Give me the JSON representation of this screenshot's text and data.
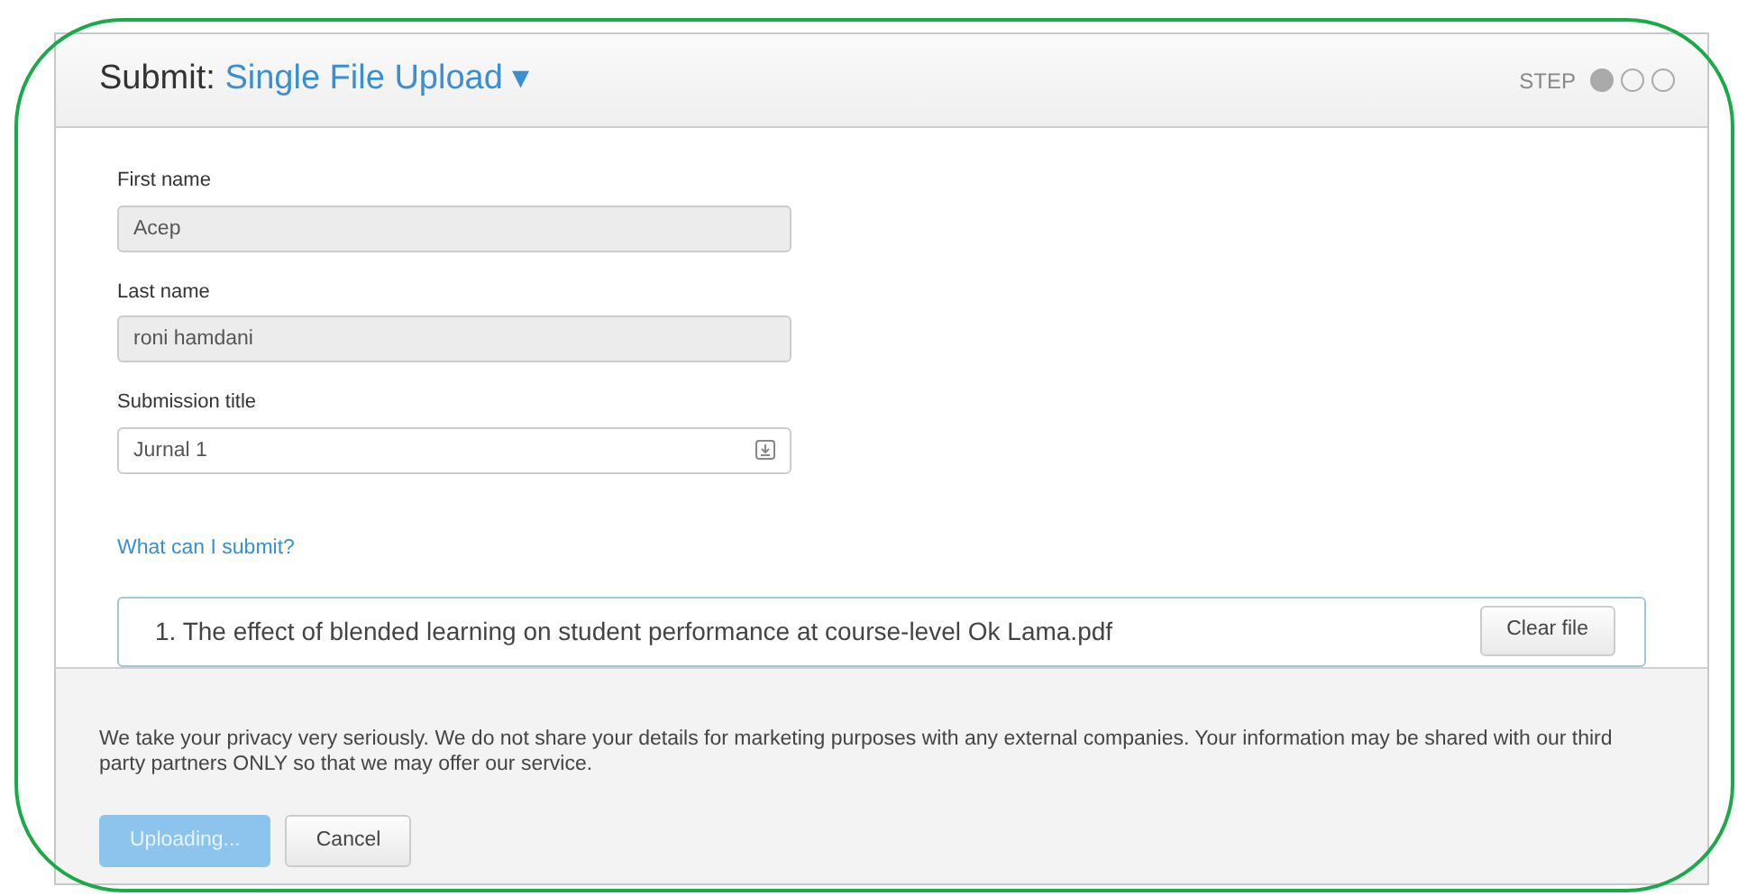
{
  "header": {
    "prefix": "Submit:",
    "title": "Single File Upload",
    "caret": "▾",
    "step_label": "STEP",
    "steps": [
      {
        "selected": true
      },
      {
        "selected": false
      },
      {
        "selected": false
      }
    ]
  },
  "fields": [
    {
      "label": "First name",
      "value": "Acep",
      "disabled": true
    },
    {
      "label": "Last name",
      "value": "roni hamdani",
      "disabled": true
    },
    {
      "label": "Submission title",
      "value": "Jurnal 1",
      "disabled": false
    }
  ],
  "help_link": "What can I submit?",
  "file": {
    "name": "1. The effect of blended learning on student performance at course-level Ok Lama.pdf",
    "button": "Clear file"
  },
  "privacy": "We take your privacy very seriously. We do not share your details for marketing purposes with any external companies. Your information may be shared with our third party partners ONLY so that we may offer our service.",
  "buttons": [
    {
      "label": "Uploading...",
      "kind": "primary",
      "disabled": true
    },
    {
      "label": "Cancel",
      "kind": "secondary",
      "disabled": false
    }
  ]
}
